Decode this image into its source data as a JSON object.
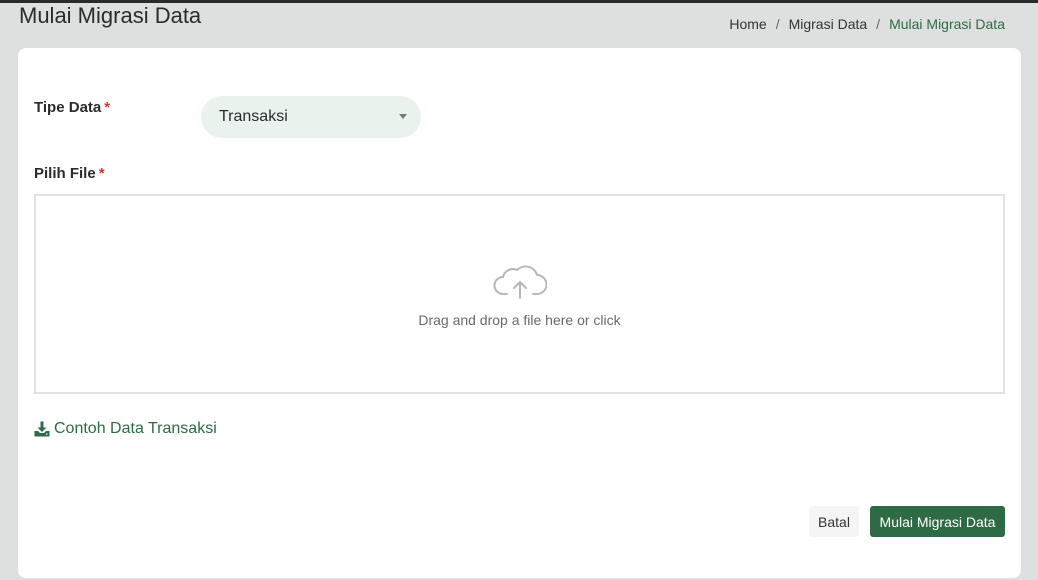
{
  "page": {
    "title": "Mulai Migrasi Data"
  },
  "breadcrumb": {
    "items": [
      "Home",
      "Migrasi Data",
      "Mulai Migrasi Data"
    ],
    "separator": "/"
  },
  "form": {
    "tipe_data": {
      "label": "Tipe Data",
      "required_mark": "*",
      "selected_value": "Transaksi"
    },
    "pilih_file": {
      "label": "Pilih File",
      "required_mark": "*",
      "dropzone_text": "Drag and drop a file here or click",
      "icon": "cloud-upload-icon"
    },
    "sample_link": {
      "label": "Contoh Data Transaksi",
      "icon": "download-icon"
    }
  },
  "actions": {
    "cancel_label": "Batal",
    "submit_label": "Mulai Migrasi Data"
  },
  "colors": {
    "accent": "#2e6b45",
    "required": "#d9342b",
    "background": "#dde0de",
    "select_background": "#eaf2ee"
  }
}
